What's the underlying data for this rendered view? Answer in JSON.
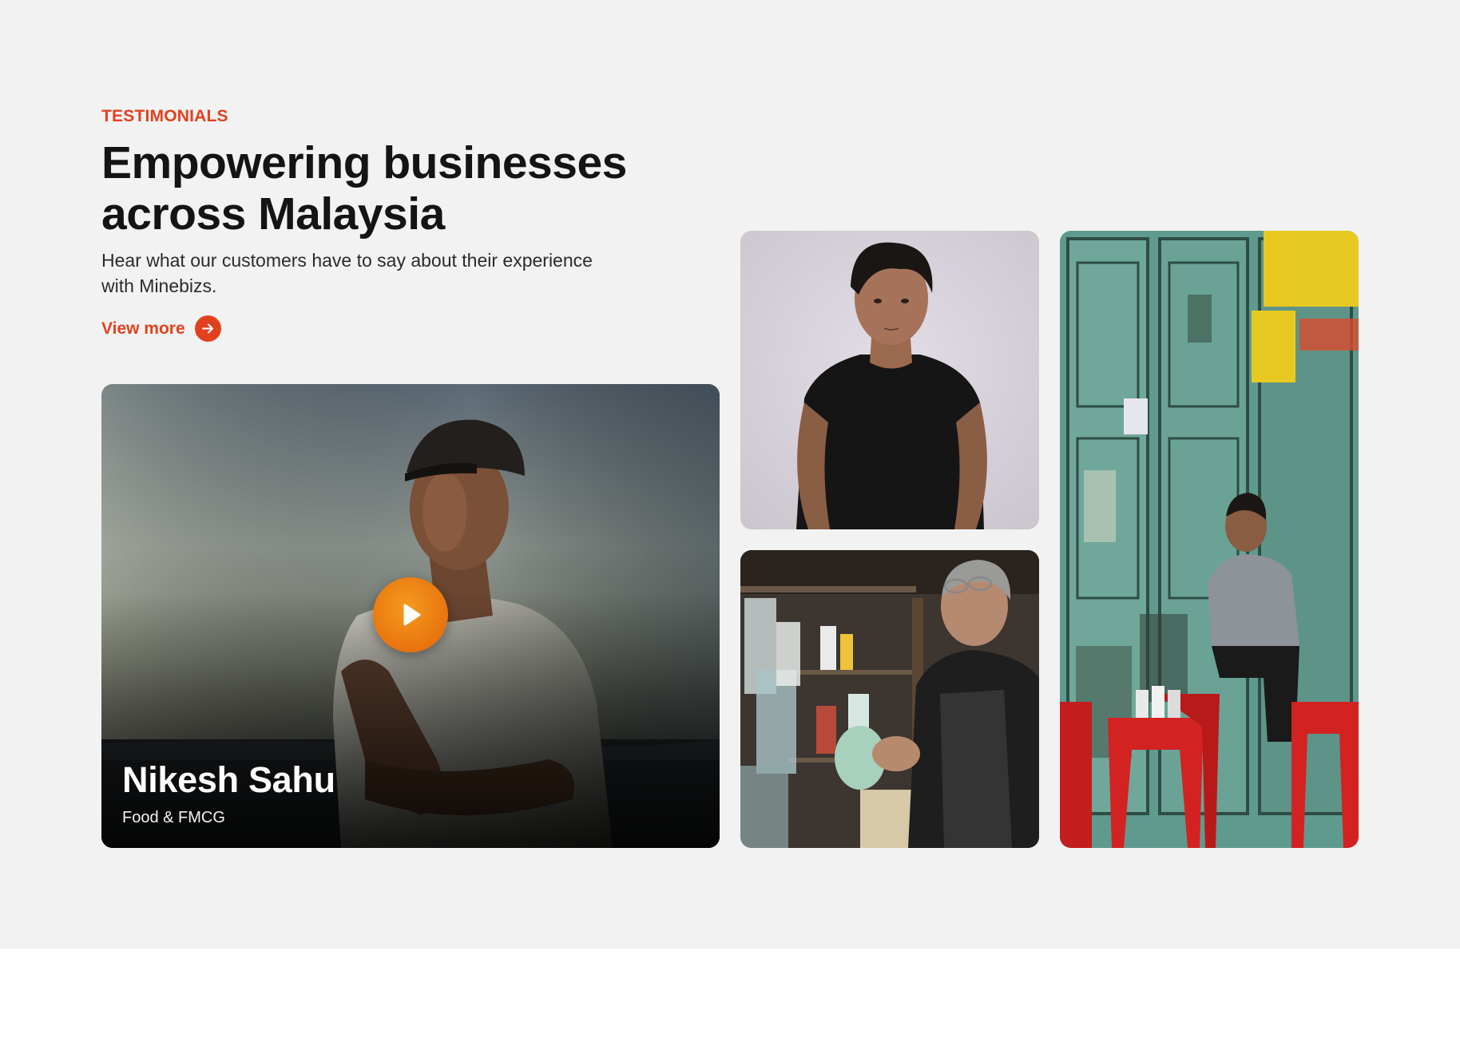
{
  "section": {
    "eyebrow": "TESTIMONIALS",
    "headline_line1": "Empowering businesses",
    "headline_line2": "across Malaysia",
    "subtext_line1": "Hear what our customers have to say about their experience",
    "subtext_line2": "with Minebizs.",
    "view_more_label": "View more"
  },
  "featured_testimonial": {
    "name": "Nikesh Sahu",
    "industry": "Food & FMCG"
  },
  "colors": {
    "accent": "#e2411f",
    "play_button": "#e8740e",
    "background": "#f2f2f2"
  },
  "icons": {
    "view_more": "arrow-right-circle-icon",
    "play": "play-icon"
  }
}
